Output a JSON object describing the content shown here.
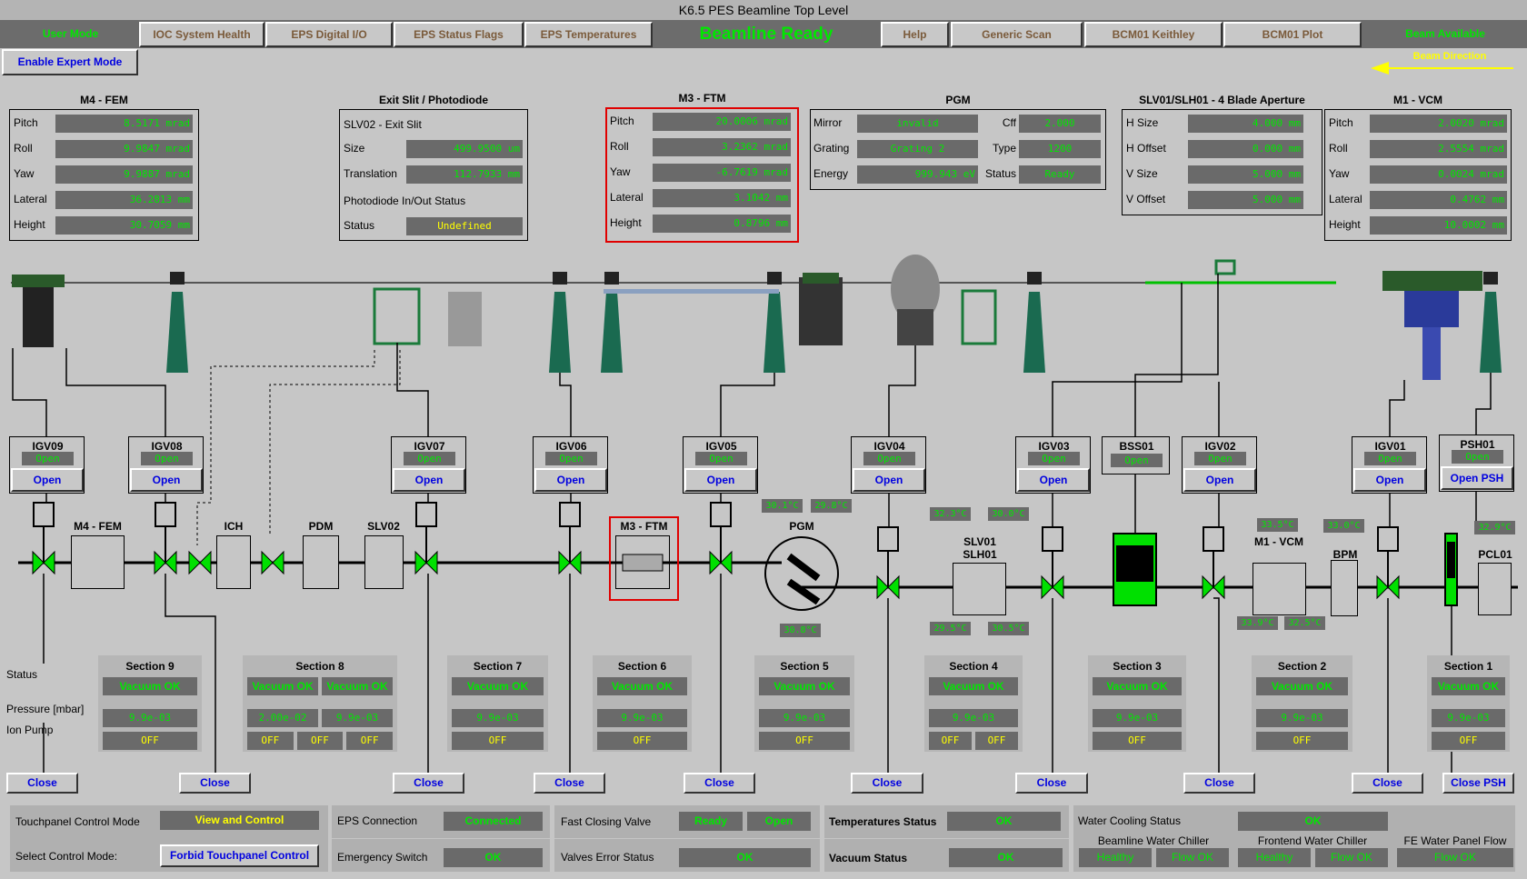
{
  "title": "K6.5 PES Beamline Top Level",
  "nav": {
    "user_mode": "User Mode",
    "buttons_left": [
      "IOC System Health",
      "EPS Digital I/O",
      "EPS Status Flags",
      "EPS Temperatures"
    ],
    "beamline_status": "Beamline Ready",
    "buttons_right": [
      "Help",
      "Generic Scan",
      "BCM01 Keithley",
      "BCM01 Plot"
    ],
    "beam_available": "Beam Available",
    "expert_mode_button": "Enable Expert Mode",
    "beam_direction": "Beam Direction"
  },
  "panels": {
    "m4_fem": {
      "title": "M4 - FEM",
      "rows": [
        {
          "label": "Pitch",
          "value": "8.5171 mrad"
        },
        {
          "label": "Roll",
          "value": "9.9847 mrad"
        },
        {
          "label": "Yaw",
          "value": "9.9887 mrad"
        },
        {
          "label": "Lateral",
          "value": "36.2813 mm"
        },
        {
          "label": "Height",
          "value": "30.7059 mm"
        }
      ]
    },
    "exit_slit": {
      "title": "Exit Slit / Photodiode",
      "subtitle": "SLV02 - Exit Slit",
      "rows": [
        {
          "label": "Size",
          "value": "499.9500 um"
        },
        {
          "label": "Translation",
          "value": "112.7933 mm"
        }
      ],
      "photodiode_label": "Photodiode In/Out Status",
      "status_label": "Status",
      "status_value": "Undefined"
    },
    "m3_ftm": {
      "title": "M3 - FTM",
      "rows": [
        {
          "label": "Pitch",
          "value": "20.0006 mrad"
        },
        {
          "label": "Roll",
          "value": "3.2362 mrad"
        },
        {
          "label": "Yaw",
          "value": "-6.7619 mrad"
        },
        {
          "label": "Lateral",
          "value": "3.1042 mm"
        },
        {
          "label": "Height",
          "value": "0.8796 mm"
        }
      ]
    },
    "pgm": {
      "title": "PGM",
      "rows": [
        {
          "label": "Mirror",
          "value": "invalid",
          "label2": "Cff",
          "value2": "2.000"
        },
        {
          "label": "Grating",
          "value": "Grating 2",
          "label2": "Type",
          "value2": "1200"
        },
        {
          "label": "Energy",
          "value": "999.943 eV",
          "label2": "Status",
          "value2": "Ready"
        }
      ]
    },
    "aperture": {
      "title": "SLV01/SLH01 - 4 Blade Aperture",
      "rows": [
        {
          "label": "H Size",
          "value": "4.000 mm"
        },
        {
          "label": "H Offset",
          "value": "0.000 mm"
        },
        {
          "label": "V Size",
          "value": "5.000 mm"
        },
        {
          "label": "V Offset",
          "value": "5.000 mm"
        }
      ]
    },
    "m1_vcm": {
      "title": "M1 - VCM",
      "rows": [
        {
          "label": "Pitch",
          "value": "2.0020 mrad"
        },
        {
          "label": "Roll",
          "value": "2.5554 mrad"
        },
        {
          "label": "Yaw",
          "value": "0.0024 mrad"
        },
        {
          "label": "Lateral",
          "value": "0.4762 mm"
        },
        {
          "label": "Height",
          "value": "10.0002 mm"
        }
      ]
    }
  },
  "valves": [
    {
      "name": "IGV09",
      "status": "Open",
      "button": "Open"
    },
    {
      "name": "IGV08",
      "status": "Open",
      "button": "Open"
    },
    {
      "name": "IGV07",
      "status": "Open",
      "button": "Open"
    },
    {
      "name": "IGV06",
      "status": "Open",
      "button": "Open"
    },
    {
      "name": "IGV05",
      "status": "Open",
      "button": "Open"
    },
    {
      "name": "IGV04",
      "status": "Open",
      "button": "Open"
    },
    {
      "name": "IGV03",
      "status": "Open",
      "button": "Open"
    },
    {
      "name": "BSS01",
      "status": "Open"
    },
    {
      "name": "IGV02",
      "status": "Open",
      "button": "Open"
    },
    {
      "name": "IGV01",
      "status": "Open",
      "button": "Open"
    },
    {
      "name": "PSH01",
      "status": "Open",
      "button": "Open PSH"
    }
  ],
  "components": [
    "M4 - FEM",
    "ICH",
    "PDM",
    "SLV02",
    "M3 - FTM",
    "PGM",
    "SLV01",
    "SLH01",
    "M1 - VCM",
    "BPM",
    "PCL01"
  ],
  "temperatures": [
    "30.1°C",
    "29.8°C",
    "32.3°C",
    "30.0°C",
    "30.8°C",
    "29.5°C",
    "30.5°C",
    "33.5°C",
    "33.0°C",
    "33.9°C",
    "32.5°C",
    "32.9°C"
  ],
  "row_labels": {
    "status": "Status",
    "pressure": "Pressure [mbar]",
    "ion_pump": "Ion Pump"
  },
  "sections": [
    {
      "title": "Section 9",
      "status": [
        "Vacuum OK"
      ],
      "pressure": [
        "9.9e-03"
      ],
      "ion_pump": [
        "OFF"
      ]
    },
    {
      "title": "Section 8",
      "status": [
        "Vacuum OK",
        "Vacuum OK"
      ],
      "pressure": [
        "2.00e-02",
        "9.9e-03"
      ],
      "ion_pump": [
        "OFF",
        "OFF",
        "OFF"
      ]
    },
    {
      "title": "Section 7",
      "status": [
        "Vacuum OK"
      ],
      "pressure": [
        "9.9e-03"
      ],
      "ion_pump": [
        "OFF"
      ]
    },
    {
      "title": "Section 6",
      "status": [
        "Vacuum OK"
      ],
      "pressure": [
        "9.9e-03"
      ],
      "ion_pump": [
        "OFF"
      ]
    },
    {
      "title": "Section 5",
      "status": [
        "Vacuum OK"
      ],
      "pressure": [
        "9.9e-03"
      ],
      "ion_pump": [
        "OFF"
      ]
    },
    {
      "title": "Section 4",
      "status": [
        "Vacuum OK"
      ],
      "pressure": [
        "9.9e-03"
      ],
      "ion_pump": [
        "OFF",
        "OFF"
      ]
    },
    {
      "title": "Section 3",
      "status": [
        "Vacuum OK"
      ],
      "pressure": [
        "9.9e-03"
      ],
      "ion_pump": [
        "OFF"
      ]
    },
    {
      "title": "Section 2",
      "status": [
        "Vacuum OK"
      ],
      "pressure": [
        "9.9e-03"
      ],
      "ion_pump": [
        "OFF"
      ]
    },
    {
      "title": "Section 1",
      "status": [
        "Vacuum OK"
      ],
      "pressure": [
        "9.9e-03"
      ],
      "ion_pump": [
        "OFF"
      ]
    }
  ],
  "close_buttons": [
    "Close",
    "Close",
    "Close",
    "Close",
    "Close",
    "Close",
    "Close",
    "Close",
    "Close",
    "Close PSH"
  ],
  "bottom": {
    "touchpanel_mode_label": "Touchpanel Control Mode",
    "touchpanel_mode_value": "View and Control",
    "select_mode_label": "Select Control Mode:",
    "select_mode_button": "Forbid Touchpanel Control",
    "eps_connection_label": "EPS Connection",
    "eps_connection_value": "Connected",
    "emergency_label": "Emergency Switch",
    "emergency_value": "OK",
    "fast_valve_label": "Fast Closing Valve",
    "fast_valve_value1": "Ready",
    "fast_valve_value2": "Open",
    "valves_error_label": "Valves Error Status",
    "valves_error_value": "OK",
    "temperatures_label": "Temperatures Status",
    "temperatures_value": "OK",
    "vacuum_label": "Vacuum Status",
    "vacuum_value": "OK",
    "water_label": "Water Cooling Status",
    "water_value": "OK",
    "beamline_chiller_label": "Beamline Water Chiller",
    "beamline_chiller_values": [
      "Healthy",
      "Flow OK"
    ],
    "frontend_chiller_label": "Frontend Water Chiller",
    "frontend_chiller_values": [
      "Healthy",
      "Flow OK"
    ],
    "fe_panel_label": "FE Water Panel Flow",
    "fe_panel_value": "Flow OK"
  },
  "colors": {
    "ok_green": "#00e800",
    "warn_yellow": "#ffff00",
    "field_grey": "#6a6a6a",
    "highlight_red": "#e00000",
    "button_blue": "#0000e0"
  }
}
